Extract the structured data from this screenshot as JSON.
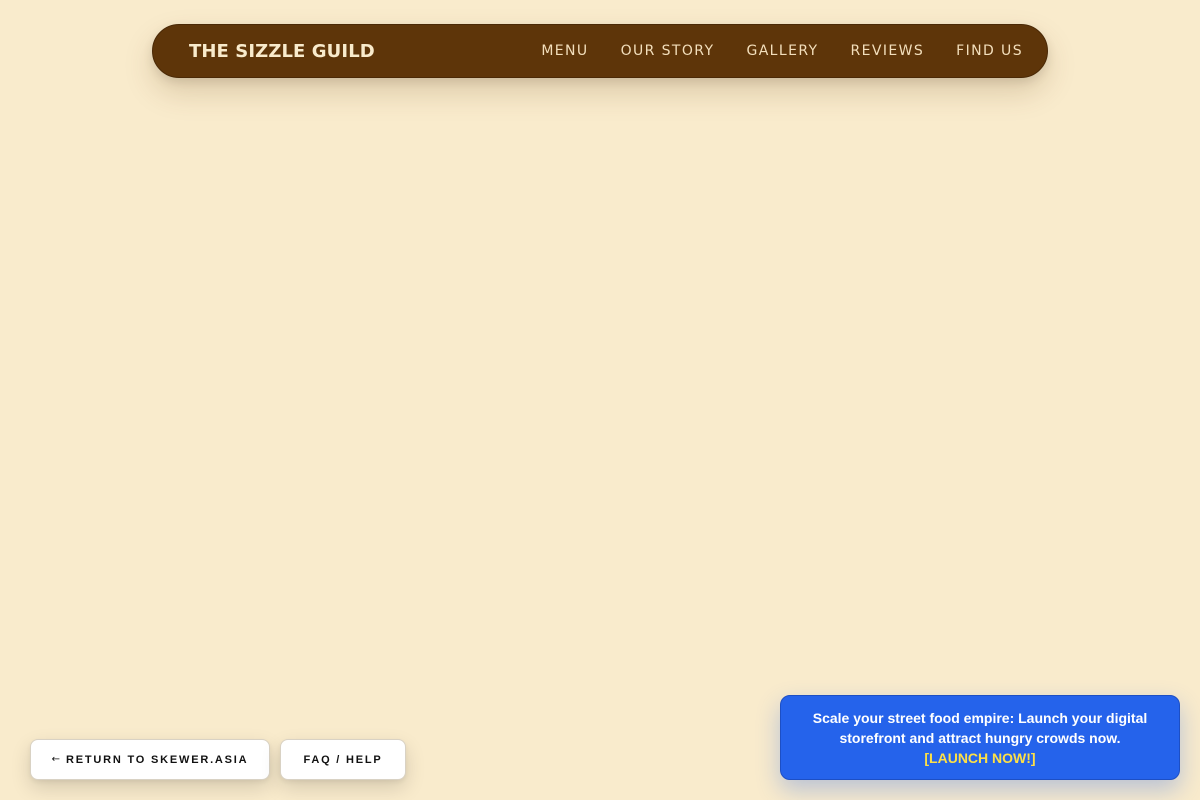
{
  "navbar": {
    "brand": "THE SIZZLE GUILD",
    "links": [
      {
        "label": "MENU"
      },
      {
        "label": "OUR STORY"
      },
      {
        "label": "GALLERY"
      },
      {
        "label": "REVIEWS"
      },
      {
        "label": "FIND US"
      }
    ]
  },
  "footer_buttons": {
    "return": {
      "arrow": "←",
      "label": "RETURN TO SKEWER.ASIA"
    },
    "faq": {
      "label": "FAQ / HELP"
    }
  },
  "promo": {
    "message": "Scale your street food empire: Launch your digital storefront and attract hungry crowds now.",
    "cta": "[LAUNCH NOW!]"
  },
  "colors": {
    "page_background": "#f9ebcc",
    "navbar_background": "#5e3509",
    "navbar_text": "#f9ebcc",
    "promo_background": "#2563eb",
    "promo_cta": "#fde047"
  }
}
